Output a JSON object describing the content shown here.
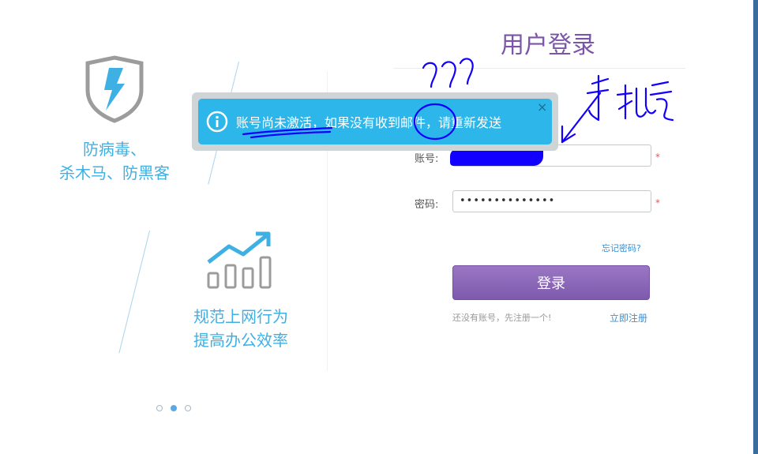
{
  "features": [
    {
      "icon": "shield-lightning-icon",
      "lines": [
        "防病毒、",
        "杀木马、防黑客"
      ]
    },
    {
      "icon": "growth-chart-icon",
      "lines": [
        "规范上网行为",
        "提高办公效率"
      ]
    }
  ],
  "carousel": {
    "count": 3,
    "active": 1
  },
  "login": {
    "title": "用户登录",
    "account_label": "账号:",
    "password_label": "密码:",
    "password_value": "••••••••••••••",
    "required_mark": "*",
    "forgot": "忘记密码?",
    "submit": "登录",
    "no_account": "还没有账号，先注册一个!",
    "register": "立即注册"
  },
  "toast": {
    "message": "账号尚未激活，如果没有收到邮件，请重新发送",
    "close": "×"
  },
  "colors": {
    "accent": "#7b56a8",
    "toast": "#2cb6ea",
    "feature_text": "#3fb0e3",
    "link": "#3b8fd1"
  }
}
